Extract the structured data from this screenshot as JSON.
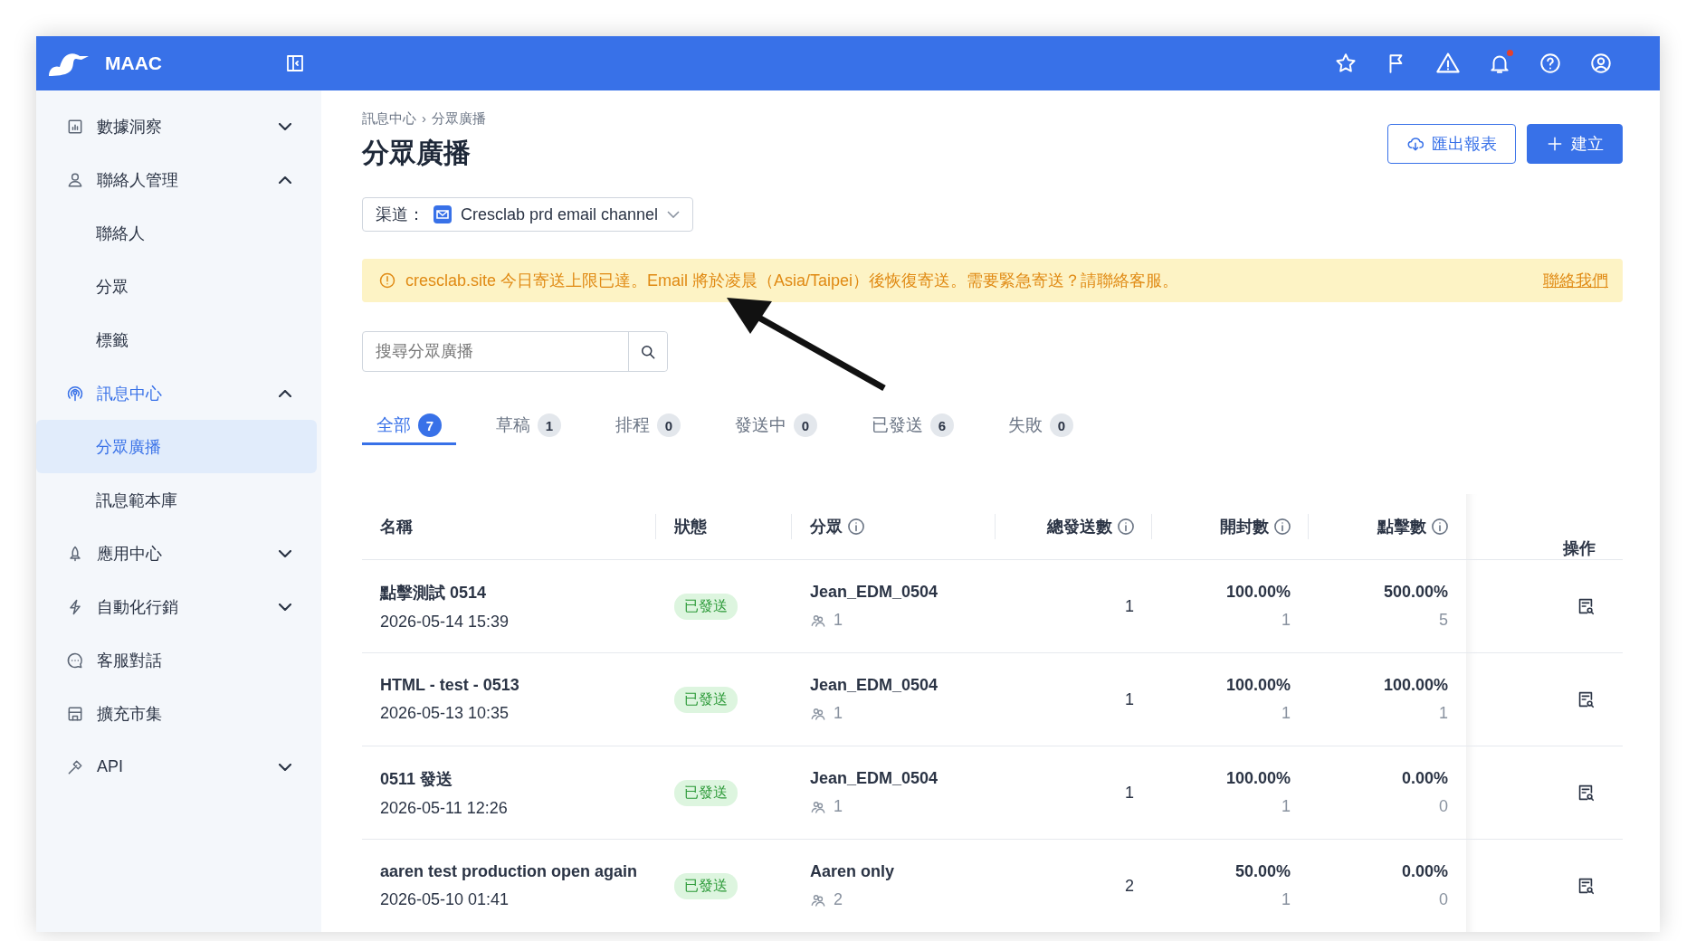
{
  "topbar": {
    "brand": "MAAC",
    "notification_dot": true
  },
  "sidebar": {
    "items": [
      {
        "label": "數據洞察",
        "expanded": false,
        "selected": false
      },
      {
        "label": "聯絡人管理",
        "expanded": true,
        "selected": false,
        "children": [
          {
            "label": "聯絡人",
            "selected": false
          },
          {
            "label": "分眾",
            "selected": false
          },
          {
            "label": "標籤",
            "selected": false
          }
        ]
      },
      {
        "label": "訊息中心",
        "expanded": true,
        "selected": true,
        "children": [
          {
            "label": "分眾廣播",
            "selected": true
          },
          {
            "label": "訊息範本庫",
            "selected": false
          }
        ]
      },
      {
        "label": "應用中心",
        "expanded": false,
        "selected": false
      },
      {
        "label": "自動化行銷",
        "expanded": false,
        "selected": false
      },
      {
        "label": "客服對話",
        "selected": false
      },
      {
        "label": "擴充市集",
        "selected": false
      },
      {
        "label": "API",
        "expanded": false,
        "selected": false
      }
    ]
  },
  "breadcrumb": [
    "訊息中心",
    "›",
    "分眾廣播"
  ],
  "title": "分眾廣播",
  "buttons": [
    {
      "kind": "outline",
      "label": "匯出報表"
    },
    {
      "kind": "primary",
      "label": "建立"
    }
  ],
  "channel": {
    "label": "渠道：",
    "value": "Cresclab prd email channel"
  },
  "alert": {
    "message": "cresclab.site 今日寄送上限已達。Email 將於凌晨（Asia/Taipei）後恢復寄送。需要緊急寄送？請聯絡客服。",
    "link": "聯絡我們"
  },
  "search": {
    "placeholder": "搜尋分眾廣播"
  },
  "tabs": [
    {
      "label": "全部",
      "count": "7",
      "selected": true
    },
    {
      "label": "草稿",
      "count": "1",
      "selected": false
    },
    {
      "label": "排程",
      "count": "0",
      "selected": false
    },
    {
      "label": "發送中",
      "count": "0",
      "selected": false
    },
    {
      "label": "已發送",
      "count": "6",
      "selected": false
    },
    {
      "label": "失敗",
      "count": "0",
      "selected": false
    }
  ],
  "table": {
    "columns": [
      {
        "label": "名稱",
        "info": false
      },
      {
        "label": "狀態",
        "info": false
      },
      {
        "label": "分眾",
        "info": true
      },
      {
        "label": "總發送數",
        "info": true
      },
      {
        "label": "開封數",
        "info": true
      },
      {
        "label": "點擊數",
        "info": true
      },
      {
        "label": "操作",
        "info": false
      }
    ],
    "rows": [
      {
        "name": "點擊測試 0514",
        "time": "2026-05-14 15:39",
        "status": "已發送",
        "segment": "Jean_EDM_0504",
        "segment_count": "1",
        "total": "1",
        "open_rate": "100.00%",
        "open_count": "1",
        "click_rate": "500.00%",
        "click_count": "5"
      },
      {
        "name": "HTML - test - 0513",
        "time": "2026-05-13 10:35",
        "status": "已發送",
        "segment": "Jean_EDM_0504",
        "segment_count": "1",
        "total": "1",
        "open_rate": "100.00%",
        "open_count": "1",
        "click_rate": "100.00%",
        "click_count": "1"
      },
      {
        "name": "0511 發送",
        "time": "2026-05-11 12:26",
        "status": "已發送",
        "segment": "Jean_EDM_0504",
        "segment_count": "1",
        "total": "1",
        "open_rate": "100.00%",
        "open_count": "1",
        "click_rate": "0.00%",
        "click_count": "0"
      },
      {
        "name": "aaren test production open again",
        "time": "2026-05-10 01:41",
        "status": "已發送",
        "segment": "Aaren only",
        "segment_count": "2",
        "total": "2",
        "open_rate": "50.00%",
        "open_count": "1",
        "click_rate": "0.00%",
        "click_count": "0"
      }
    ]
  }
}
